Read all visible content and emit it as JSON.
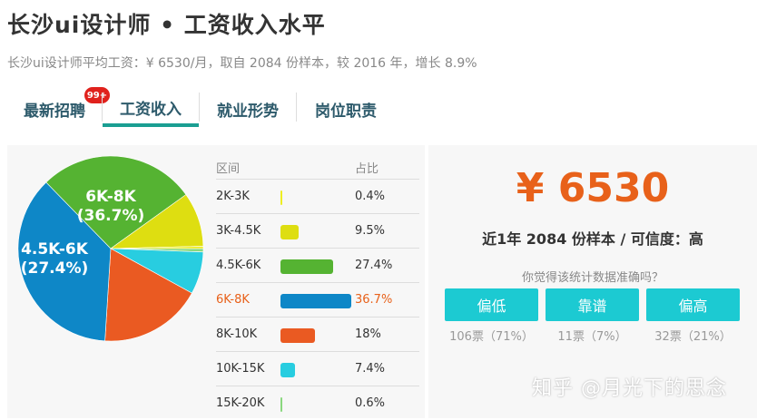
{
  "header": {
    "title": "长沙ui设计师 • 工资收入水平",
    "subtitle": "长沙ui设计师平均工资：¥ 6530/月，取自 2084 份样本，较 2016 年，增长 8.9%"
  },
  "tabs": [
    {
      "label": "最新招聘",
      "badge": "99+"
    },
    {
      "label": "工资收入"
    },
    {
      "label": "就业形势"
    },
    {
      "label": "岗位职责"
    }
  ],
  "table": {
    "col_range": "区间",
    "col_share": "占比"
  },
  "chart_data": {
    "type": "pie",
    "categories": [
      "2K-3K",
      "3K-4.5K",
      "4.5K-6K",
      "6K-8K",
      "8K-10K",
      "10K-15K",
      "15K-20K"
    ],
    "values": [
      0.4,
      9.5,
      27.4,
      36.7,
      18,
      7.4,
      0.6
    ],
    "value_labels": [
      "0.4%",
      "9.5%",
      "27.4%",
      "36.7%",
      "18%",
      "7.4%",
      "0.6%"
    ],
    "colors": [
      "#eeee22",
      "#dede11",
      "#55b332",
      "#0e87c7",
      "#ea5a22",
      "#28cde0",
      "#8ad87f"
    ],
    "slice_labels": [
      {
        "range": "6K-8K",
        "pct": "(36.7%)"
      },
      {
        "range": "4.5K-6K",
        "pct": "(27.4%)"
      }
    ],
    "highlight": "6K-8K"
  },
  "summary": {
    "salary": "¥ 6530",
    "meta": "近1年 2084 份样本 / 可信度：高",
    "question": "你觉得该统计数据准确吗？",
    "buttons": [
      {
        "label": "偏低",
        "votes": "106票（71%）"
      },
      {
        "label": "靠谱",
        "votes": "11票（7%）"
      },
      {
        "label": "偏高",
        "votes": "32票（21%）"
      }
    ]
  },
  "watermark": "知乎 @月光下的思念"
}
